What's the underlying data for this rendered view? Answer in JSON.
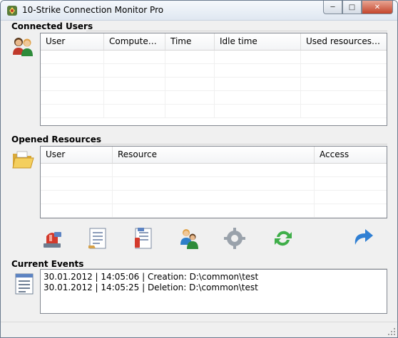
{
  "window": {
    "title": "10-Strike Connection Monitor Pro"
  },
  "connected_users": {
    "label": "Connected Users",
    "columns": [
      "User",
      "Computer [...",
      "Time",
      "Idle time",
      "Used resources co..."
    ],
    "rows": []
  },
  "opened_resources": {
    "label": "Opened Resources",
    "columns": [
      "User",
      "Resource",
      "Access"
    ],
    "rows": []
  },
  "toolbar": {
    "buttons": [
      {
        "name": "alarm-icon"
      },
      {
        "name": "report-icon"
      },
      {
        "name": "report-settings-icon"
      },
      {
        "name": "users-icon"
      },
      {
        "name": "gear-icon"
      },
      {
        "name": "refresh-icon"
      },
      {
        "name": "redo-arrow-icon"
      }
    ]
  },
  "current_events": {
    "label": "Current Events",
    "lines": [
      "30.01.2012 | 14:05:06 | Creation: D:\\common\\test",
      "30.01.2012 | 14:05:25 | Deletion: D:\\common\\test"
    ]
  }
}
